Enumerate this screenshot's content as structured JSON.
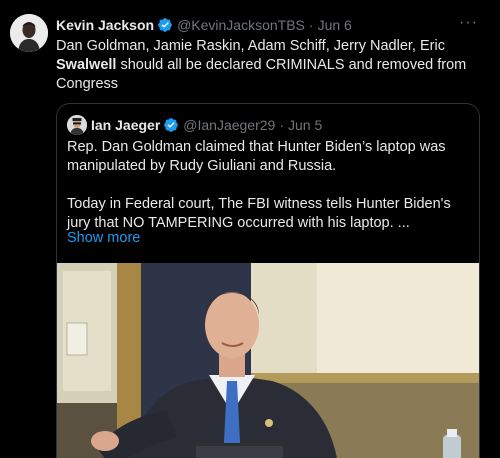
{
  "tweet": {
    "author_name": "Kevin Jackson",
    "author_handle": "@KevinJacksonTBS",
    "time": "Jun 6",
    "text_before": "Dan Goldman, Jamie Raskin, Adam Schiff, Jerry Nadler, Eric ",
    "text_bold": "Swalwell",
    "text_after": " should all be declared CRIMINALS and removed from Congress",
    "more_icon": "more-dots-icon",
    "verified_icon": "verified-badge-icon"
  },
  "quote": {
    "author_name": "Ian Jaeger",
    "author_handle": "@IanJaeger29",
    "time": "Jun 5",
    "paragraph1": "Rep. Dan Goldman claimed that Hunter Biden’s laptop was manipulated by Rudy Giuliani and Russia.",
    "paragraph2": "Today in Federal court, The FBI witness tells Hunter Biden's jury that NO TAMPERING occurred with his laptop. ...",
    "show_more": "Show more"
  },
  "colors": {
    "background": "#000000",
    "text": "#e7e9ea",
    "muted": "#71767b",
    "accent": "#1d9bf0",
    "border": "#2f3336"
  }
}
